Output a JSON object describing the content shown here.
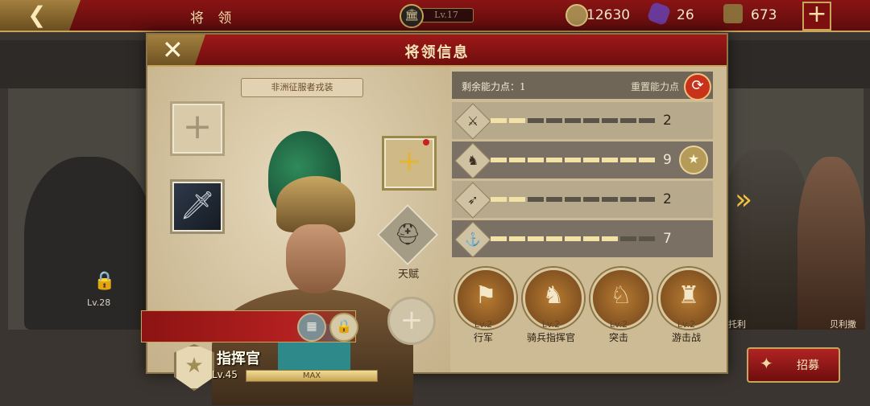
{
  "topbar": {
    "back_icon": "back-arrow-icon",
    "title": "将 领",
    "player_level": "Lv.17",
    "gold": "12630",
    "gems": "26",
    "troops": "673",
    "plus_label": "+"
  },
  "background": {
    "left_card_level": "Lv.28",
    "right_card1_name": "托利",
    "right_card2_name": "贝利撒"
  },
  "modal": {
    "title": "将领信息",
    "close_icon": "close-icon",
    "costume_tag": "非洲征服者戎装",
    "talent_label": "天赋",
    "commander_title": "指挥官",
    "level": "Lv.45",
    "level_state": "MAX",
    "level_progress": 1.0
  },
  "abilities": {
    "remaining_label": "剩余能力点：",
    "remaining_value": "1",
    "reset_label": "重置能力点",
    "stats": [
      {
        "icon": "sword-icon",
        "value": "2",
        "filled": 2,
        "total": 9
      },
      {
        "icon": "horse-icon",
        "value": "9",
        "filled": 9,
        "total": 9
      },
      {
        "icon": "bow-icon",
        "value": "2",
        "filled": 2,
        "total": 9
      },
      {
        "icon": "anchor-icon",
        "value": "7",
        "filled": 7,
        "total": 9
      }
    ]
  },
  "skills": [
    {
      "level": "Lv.2",
      "name": "行军"
    },
    {
      "level": "Lv.2",
      "name": "骑兵指挥官"
    },
    {
      "level": "Lv.2",
      "name": "突击"
    },
    {
      "level": "Lv.2",
      "name": "游击战"
    }
  ],
  "recruit_label": "招募",
  "colors": {
    "header_red": "#8a1414",
    "gold_trim": "#c9a55a",
    "panel_bg": "#cdbb95"
  }
}
